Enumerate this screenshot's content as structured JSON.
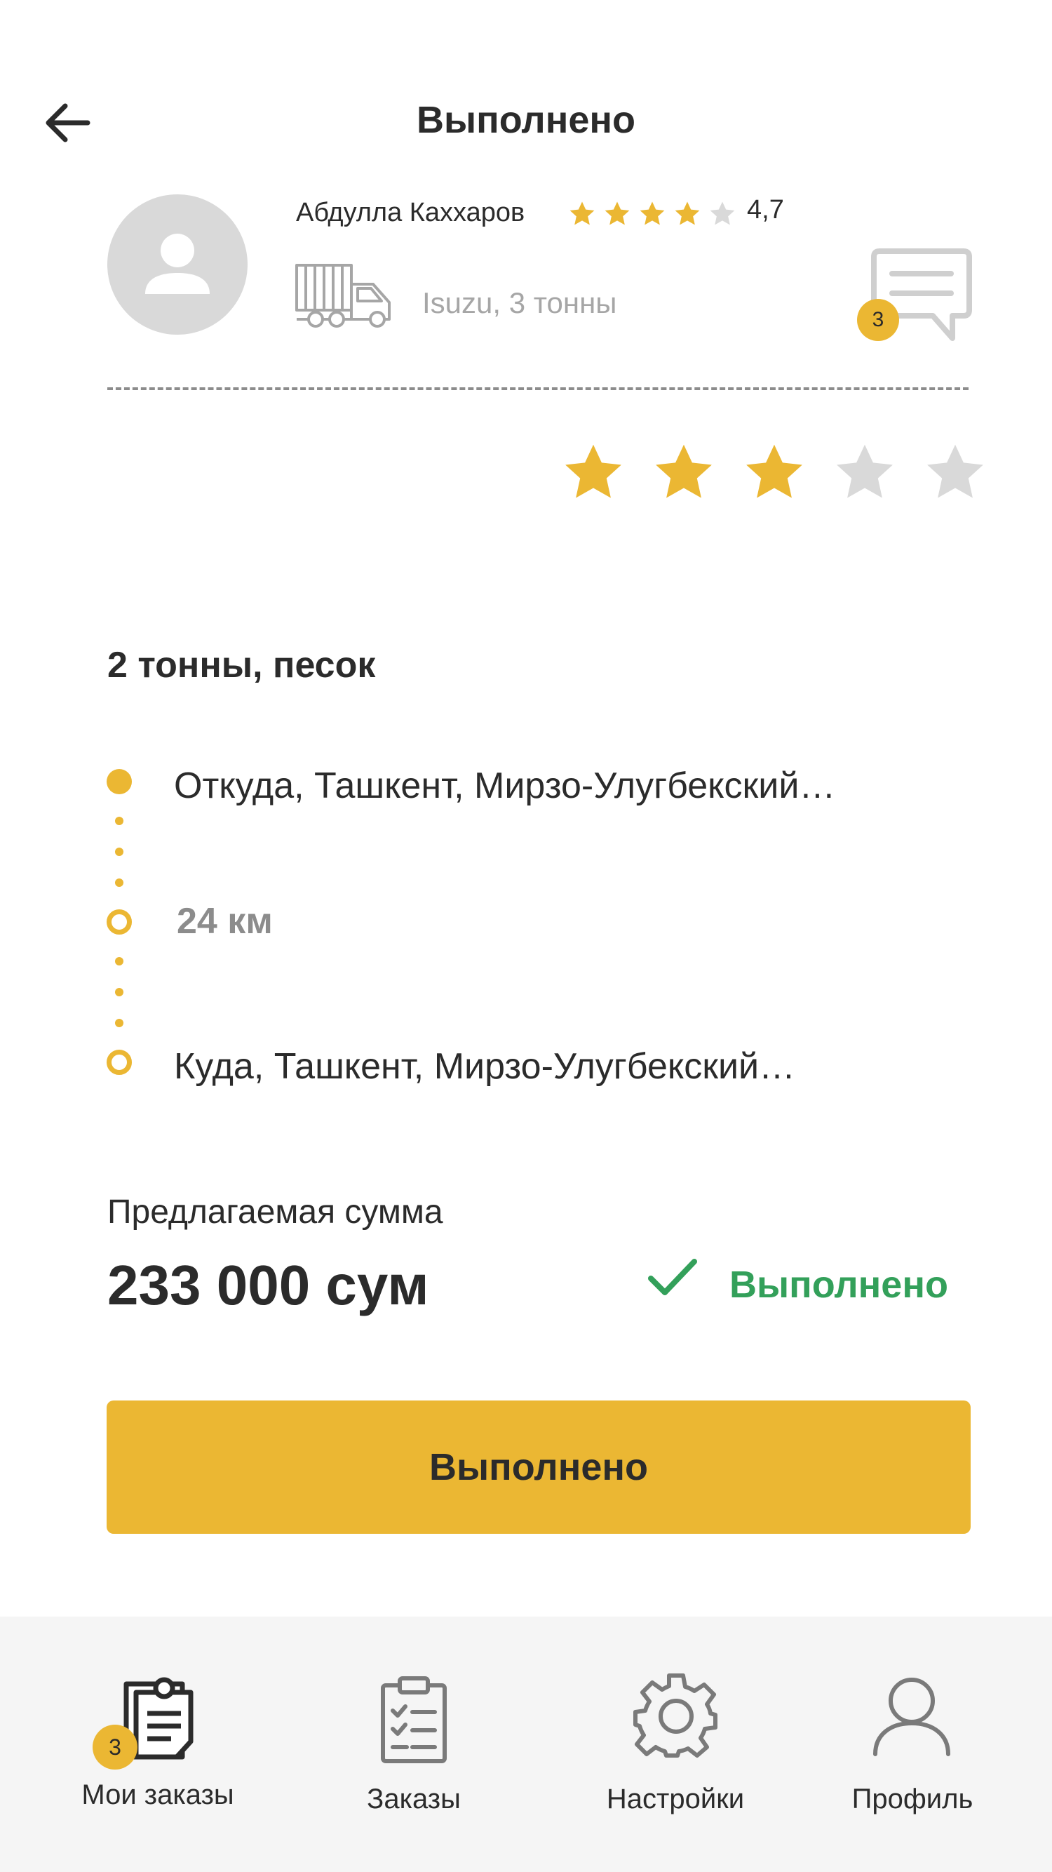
{
  "header": {
    "title": "Выполнено"
  },
  "driver": {
    "name": "Абдулла Каххаров",
    "rating": "4,7",
    "rating_stars_filled": 4,
    "rating_stars_total": 5,
    "vehicle": "Isuzu, 3 тонны",
    "chat_badge": "3"
  },
  "user_rating": {
    "filled": 3,
    "total": 5
  },
  "cargo": {
    "title": "2 тонны, песок"
  },
  "route": {
    "from": "Откуда, Ташкент, Мирзо-Улугбекский…",
    "distance": "24 км",
    "to": "Куда, Ташкент, Мирзо-Улугбекский…"
  },
  "price": {
    "label": "Предлагаемая сумма",
    "value": "233 000 сум",
    "status": "Выполнено"
  },
  "main_button": {
    "label": "Выполнено"
  },
  "bottom_nav": {
    "items": [
      {
        "label": "Мои заказы",
        "icon": "my-orders-icon",
        "badge": "3"
      },
      {
        "label": "Заказы",
        "icon": "clipboard-icon"
      },
      {
        "label": "Настройки",
        "icon": "gear-icon"
      },
      {
        "label": "Профиль",
        "icon": "person-icon"
      }
    ]
  },
  "colors": {
    "accent": "#ebb733",
    "success": "#33a05a",
    "text": "#2b2b2b",
    "muted": "#a6a6a6",
    "nav_background": "#f5f5f5"
  }
}
